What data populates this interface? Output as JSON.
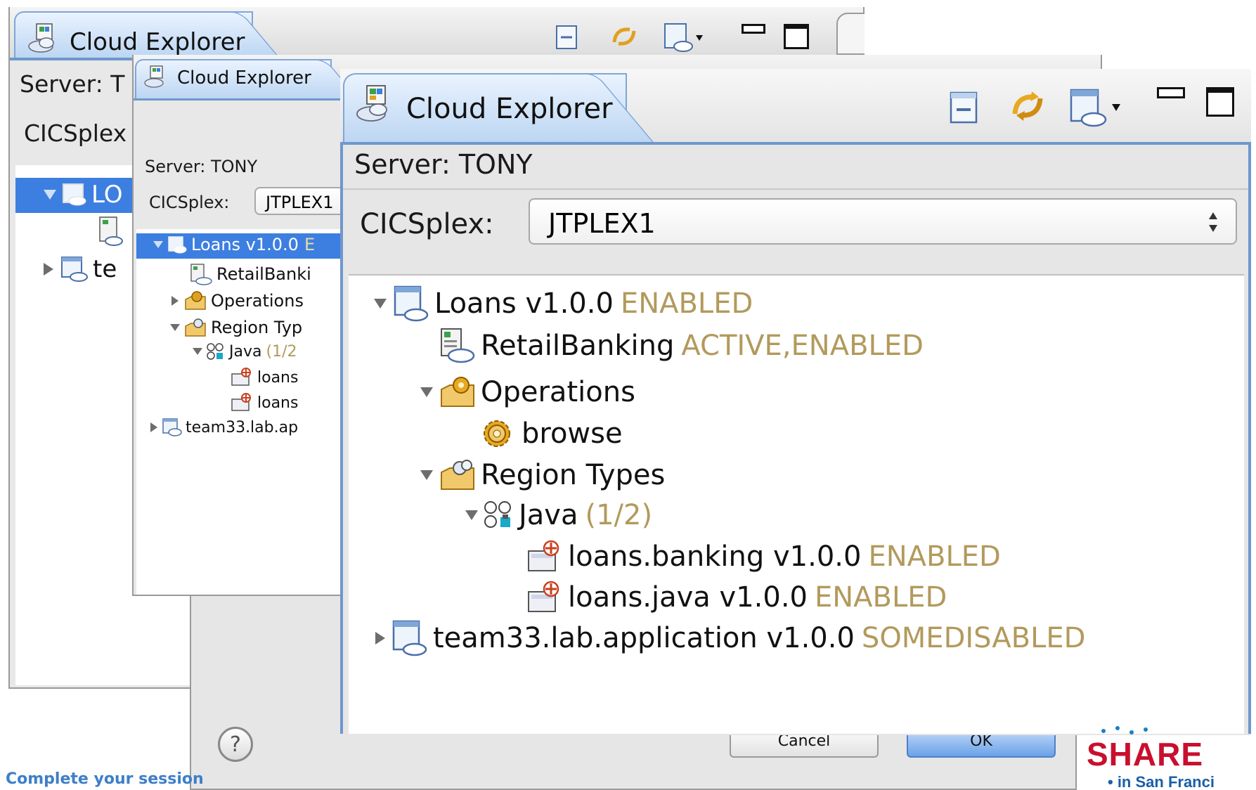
{
  "back_window": {
    "tab_title": "Cloud Explorer",
    "server_label": "Server: T",
    "cicsplex_label": "CICSplex",
    "rows": [
      "LO",
      "te"
    ]
  },
  "middle_window": {
    "tab_title": "Cloud Explorer",
    "server_label": "Server: TONY",
    "cicsplex_label": "CICSplex:",
    "cicsplex_value": "JTPLEX1",
    "tree": [
      {
        "label": "Loans v1.0.0",
        "status": "E"
      },
      {
        "label": "RetailBanki",
        "status": ""
      },
      {
        "label": "Operations",
        "status": ""
      },
      {
        "label": "Region Typ",
        "status": ""
      },
      {
        "label": "Java",
        "status": "(1/2"
      },
      {
        "label": "loans",
        "status": ""
      },
      {
        "label": "loans",
        "status": ""
      },
      {
        "label": "team33.lab.ap",
        "status": ""
      }
    ]
  },
  "front_window": {
    "tab_title": "Cloud Explorer",
    "server_label": "Server: TONY",
    "cicsplex_label": "CICSplex:",
    "cicsplex_value": "JTPLEX1",
    "tree": [
      {
        "label": "Loans v1.0.0",
        "status": "ENABLED"
      },
      {
        "label": "RetailBanking",
        "status": "ACTIVE,ENABLED"
      },
      {
        "label": "Operations",
        "status": ""
      },
      {
        "label": "browse",
        "status": ""
      },
      {
        "label": "Region Types",
        "status": ""
      },
      {
        "label": "Java",
        "status": "(1/2)"
      },
      {
        "label": "loans.banking v1.0.0",
        "status": "ENABLED"
      },
      {
        "label": "loans.java v1.0.0",
        "status": "ENABLED"
      },
      {
        "label": "team33.lab.application v1.0.0",
        "status": "SOMEDISABLED"
      }
    ]
  },
  "dialog": {
    "help_glyph": "?",
    "cancel_label": "Cancel",
    "ok_label": "OK"
  },
  "footer": {
    "caption": "Complete your session",
    "share_logo": "SHARE",
    "share_sub": "• in San Franci"
  },
  "colors": {
    "status": "#b29a5c",
    "selection": "#3d7fe0",
    "tab_border": "#7fa6d8",
    "share_red": "#c8102e"
  }
}
